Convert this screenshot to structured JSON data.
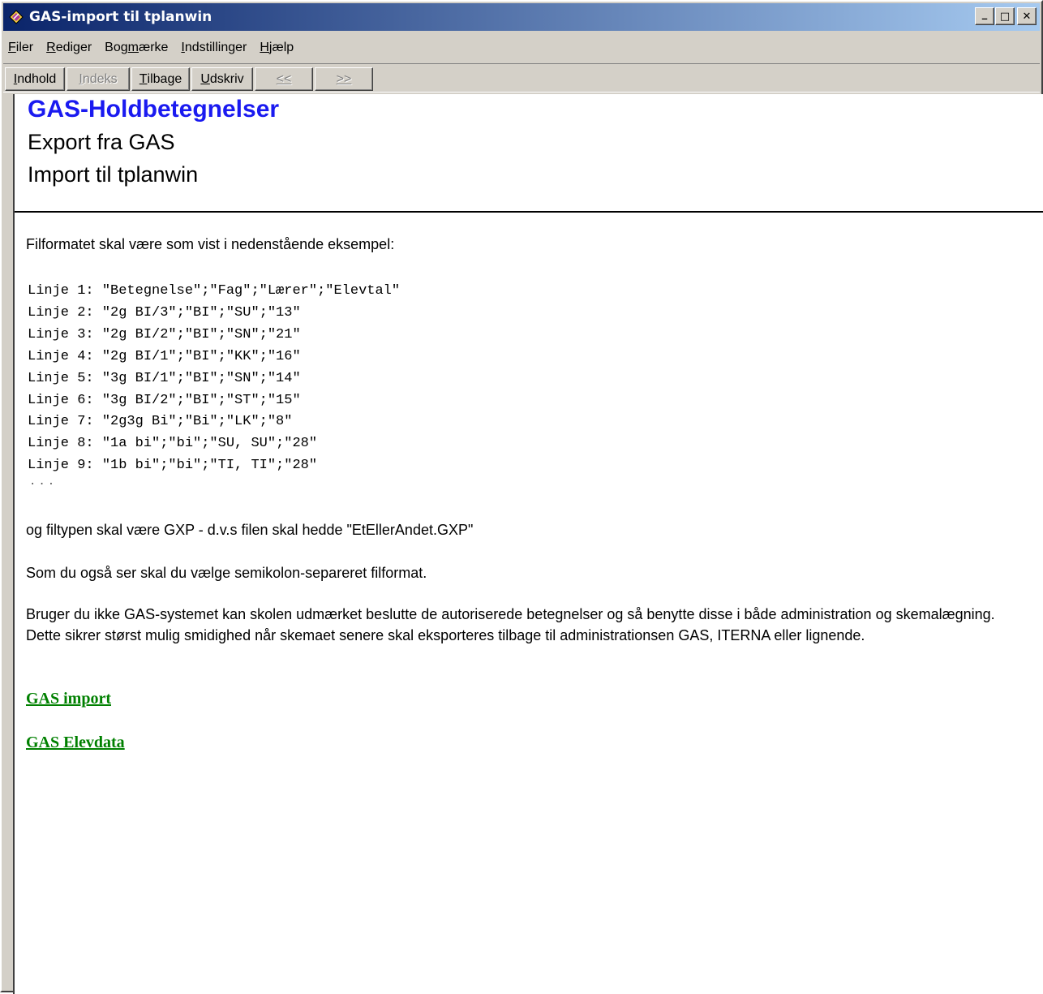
{
  "window": {
    "title": "GAS-import til tplanwin",
    "controls": {
      "minimize": "_",
      "maximize": "□",
      "close": "✕"
    }
  },
  "menu": {
    "items": [
      {
        "first": "F",
        "rest": "iler"
      },
      {
        "first": "R",
        "rest": "ediger"
      },
      {
        "pre": "Bog",
        "first": "m",
        "rest": "ærke"
      },
      {
        "first": "I",
        "rest": "ndstillinger"
      },
      {
        "first": "H",
        "rest": "jælp"
      }
    ]
  },
  "toolbar": {
    "contents": {
      "first": "I",
      "rest": "ndhold"
    },
    "index": {
      "first": "I",
      "rest": "ndeks"
    },
    "back": {
      "first": "T",
      "rest": "ilbage"
    },
    "print": {
      "first": "U",
      "rest": "dskriv"
    },
    "prev": "<<",
    "next": ">>"
  },
  "header": {
    "title": "GAS-Holdbetegnelser",
    "line1": "Export fra GAS",
    "line2": "Import til tplanwin"
  },
  "body": {
    "intro": "Filformatet skal være som vist i nedenstående eksempel:",
    "code_lines": [
      "Linje 1: \"Betegnelse\";\"Fag\";\"Lærer\";\"Elevtal\"",
      "Linje 2: \"2g BI/3\";\"BI\";\"SU\";\"13\"",
      "Linje 3: \"2g BI/2\";\"BI\";\"SN\";\"21\"",
      "Linje 4: \"2g BI/1\";\"BI\";\"KK\";\"16\"",
      "Linje 5: \"3g BI/1\";\"BI\";\"SN\";\"14\"",
      "Linje 6: \"3g BI/2\";\"BI\";\"ST\";\"15\"",
      "Linje 7: \"2g3g Bi\";\"Bi\";\"LK\";\"8\"",
      "Linje 8: \"1a bi\";\"bi\";\"SU, SU\";\"28\"",
      "Linje 9: \"1b bi\";\"bi\";\"TI, TI\";\"28\""
    ],
    "ellipsis": "...",
    "filetype": "og filtypen skal være GXP - d.v.s filen skal hedde \"EtEllerAndet.GXP\"",
    "separator": "Som du også ser skal du vælge semikolon-separeret filformat.",
    "paragraph": "Bruger du ikke GAS-systemet kan skolen udmærket beslutte de autoriserede betegnelser og så benytte disse i både administration og skemalægning. Dette sikrer størst mulig smidighed når skemaet senere skal eksporteres tilbage til administrationsen GAS, ITERNA eller lignende."
  },
  "links": {
    "gas_import": "GAS import",
    "gas_elevdata": "GAS Elevdata"
  },
  "colors": {
    "title_blue": "#1a1af0",
    "link_green": "#008000",
    "titlebar_start": "#0a246a",
    "titlebar_end": "#a6caf0"
  }
}
